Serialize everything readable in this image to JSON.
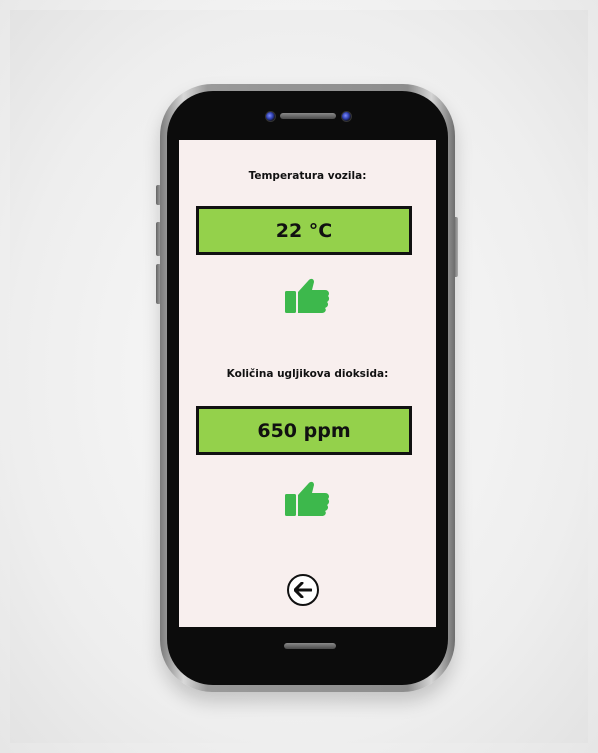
{
  "screen": {
    "temperature": {
      "label": "Temperatura vozila:",
      "value": "22 °C",
      "status_icon": "thumbs-up-icon"
    },
    "co2": {
      "label": "Količina ugljikova dioksida:",
      "value": "650 ppm",
      "status_icon": "thumbs-up-icon"
    },
    "back_icon": "arrow-left-icon"
  },
  "colors": {
    "screen_background": "#f8efee",
    "value_box_fill": "#94d14b",
    "thumb_green": "#3db84c"
  }
}
